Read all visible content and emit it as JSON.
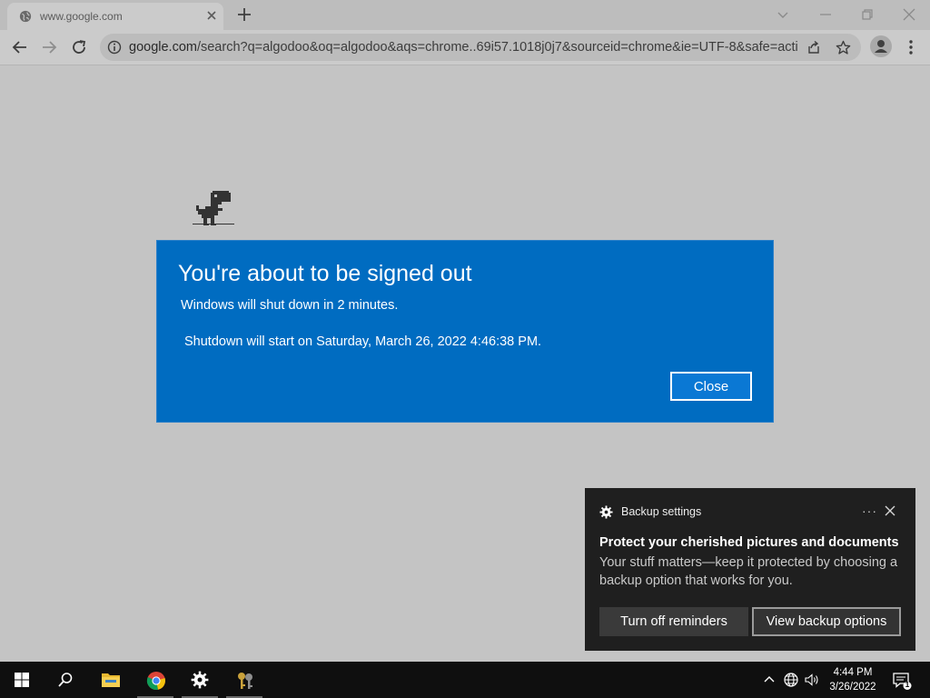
{
  "browser": {
    "tab_title": "www.google.com",
    "url_host": "google.com",
    "url_rest": "/search?q=algodoo&oq=algodoo&aqs=chrome..69i57.1018j0j7&sourceid=chrome&ie=UTF-8&safe=acti..."
  },
  "dialog": {
    "title": "You're about to be signed out",
    "line1": "Windows will shut down in 2 minutes.",
    "line2": "Shutdown will start on Saturday, March 26, 2022 4:46:38 PM.",
    "close_label": "Close",
    "background_color": "#006cc1"
  },
  "toast": {
    "app_name": "Backup settings",
    "more_label": "···",
    "title": "Protect your cherished pictures and documents",
    "body": "Your stuff matters—keep it protected by choosing a backup option that works for you.",
    "button_dismiss": "Turn off reminders",
    "button_primary": "View backup options"
  },
  "taskbar": {
    "time": "4:44 PM",
    "date": "3/26/2022",
    "notification_count": "1"
  }
}
